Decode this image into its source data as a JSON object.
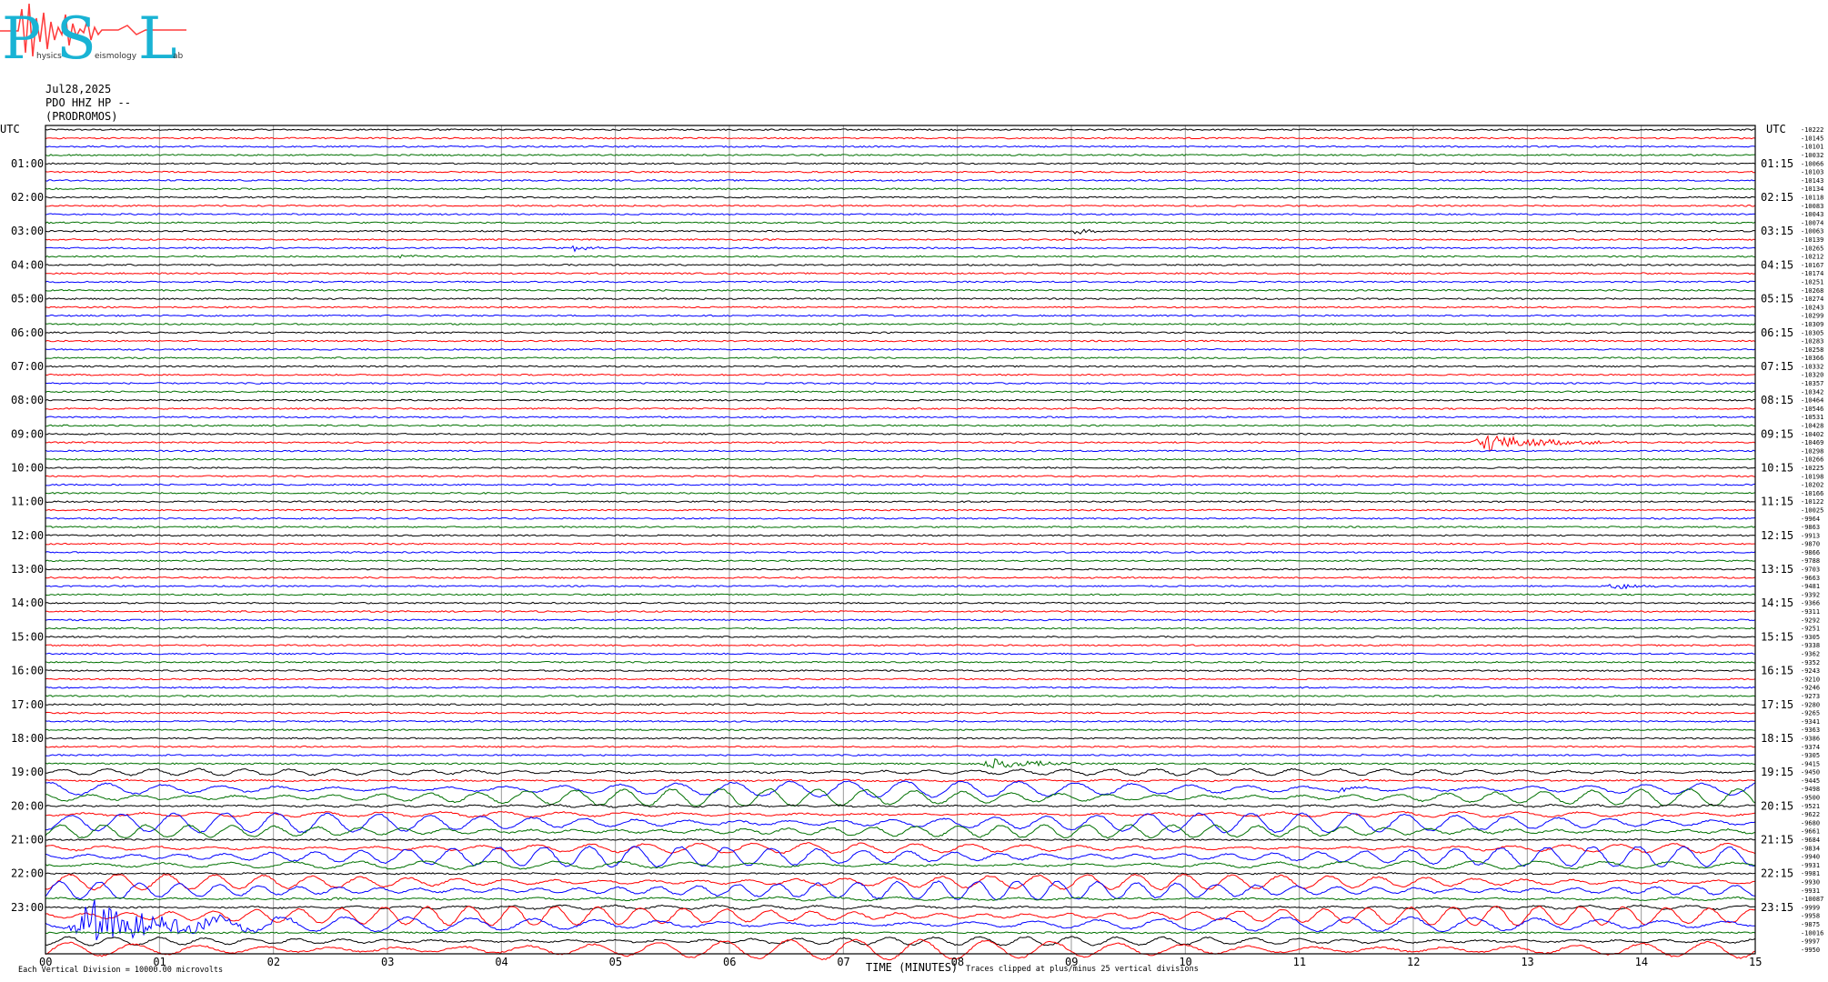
{
  "logo": {
    "letters": [
      "P",
      "S",
      "L"
    ],
    "small_words": [
      "hysics",
      "eismology",
      "ab"
    ],
    "colors": {
      "letters": "#19b3d4",
      "wave": "#ff3b3b"
    }
  },
  "header": {
    "date": "Jul28,2025",
    "station": "PDO HHZ HP --",
    "site": "(PRODROMOS)"
  },
  "axes": {
    "left_unit": "UTC",
    "right_unit": "UTC",
    "xlabel": "TIME (MINUTES)",
    "footer_left": "Each Vertical Division = 10000.00 microvolts",
    "footer_right": "Traces clipped at plus/minus 25 vertical divisions"
  },
  "chart_data": {
    "type": "line",
    "title": "",
    "xlabel": "TIME (MINUTES)",
    "x_ticks": [
      "00",
      "01",
      "02",
      "03",
      "04",
      "05",
      "06",
      "07",
      "08",
      "09",
      "10",
      "11",
      "12",
      "13",
      "14",
      "15"
    ],
    "xlim": [
      0,
      15
    ],
    "trace_minutes": 15,
    "traces_per_hour": 4,
    "trace_colors": [
      "#000000",
      "#ff0000",
      "#0000ff",
      "#007000"
    ],
    "grid": true,
    "left_hour_labels": [
      "01:00",
      "02:00",
      "03:00",
      "04:00",
      "05:00",
      "06:00",
      "07:00",
      "08:00",
      "09:00",
      "10:00",
      "11:00",
      "12:00",
      "13:00",
      "14:00",
      "15:00",
      "16:00",
      "17:00",
      "18:00",
      "19:00",
      "20:00",
      "21:00",
      "22:00",
      "23:00"
    ],
    "right_hour_labels": [
      "01:15",
      "02:15",
      "03:15",
      "04:15",
      "05:15",
      "06:15",
      "07:15",
      "08:15",
      "09:15",
      "10:15",
      "11:15",
      "12:15",
      "13:15",
      "14:15",
      "15:15",
      "16:15",
      "17:15",
      "18:15",
      "19:15",
      "20:15",
      "21:15",
      "22:15",
      "23:15"
    ],
    "trace_offsets": [
      "-10222",
      "-10145",
      "-10101",
      "-10032",
      "-10066",
      "-10103",
      "-10143",
      "-10134",
      "-10118",
      "-10083",
      "-10043",
      "-10074",
      "-10063",
      "-10139",
      "-10265",
      "-10212",
      "-10167",
      "-10174",
      "-10251",
      "-10268",
      "-10274",
      "-10243",
      "-10299",
      "-10309",
      "-10305",
      "-10283",
      "-10258",
      "-10366",
      "-10332",
      "-10320",
      "-10357",
      "-10342",
      "-10464",
      "-10546",
      "-10531",
      "-10428",
      "-10402",
      "-10469",
      "-10298",
      "-10266",
      "-10225",
      "-10198",
      "-10202",
      "-10166",
      "-10122",
      "-10025",
      "-9964",
      "-9863",
      "-9913",
      "-9870",
      "-9866",
      "-9788",
      "-9703",
      "-9663",
      "-9481",
      "-9392",
      "-9366",
      "-9311",
      "-9292",
      "-9251",
      "-9305",
      "-9338",
      "-9362",
      "-9352",
      "-9243",
      "-9210",
      "-9246",
      "-9273",
      "-9280",
      "-9265",
      "-9341",
      "-9363",
      "-9386",
      "-9374",
      "-9305",
      "-9415",
      "-9450",
      "-9445",
      "-9498",
      "-9500",
      "-9521",
      "-9622",
      "-9680",
      "-9661",
      "-9684",
      "-9834",
      "-9940",
      "-9931",
      "-9981",
      "-9930",
      "-9931",
      "-10087",
      "-9999",
      "-9958",
      "-9875",
      "-10016",
      "-9997",
      "-9950"
    ],
    "events": [
      {
        "trace": 12,
        "start_min": 9.0,
        "end_min": 9.4,
        "amplitude": 6,
        "color": "#000000"
      },
      {
        "trace": 14,
        "start_min": 4.6,
        "end_min": 5.0,
        "amplitude": 6,
        "color": "#0000ff"
      },
      {
        "trace": 15,
        "start_min": 3.1,
        "end_min": 3.5,
        "amplitude": 3,
        "color": "#007000"
      },
      {
        "trace": 37,
        "start_min": 12.5,
        "end_min": 13.9,
        "amplitude": 14,
        "color": "#ff0000"
      },
      {
        "trace": 54,
        "start_min": 13.7,
        "end_min": 14.4,
        "amplitude": 5,
        "color": "#0000ff"
      },
      {
        "trace": 75,
        "start_min": 8.2,
        "end_min": 9.5,
        "amplitude": 7,
        "color": "#007000"
      },
      {
        "trace": 78,
        "start_min": 11.3,
        "end_min": 11.7,
        "amplitude": 4,
        "color": "#0000ff"
      },
      {
        "trace": 91,
        "start_min": 2.5,
        "end_min": 3.1,
        "amplitude": 3,
        "color": "#007000"
      },
      {
        "trace": 94,
        "start_min": 0.2,
        "end_min": 2.2,
        "amplitude": 34,
        "color": "#0000ff"
      }
    ],
    "quake_window": {
      "start_trace": 76,
      "end_trace": 97,
      "long_period_amplitude": 11
    }
  }
}
